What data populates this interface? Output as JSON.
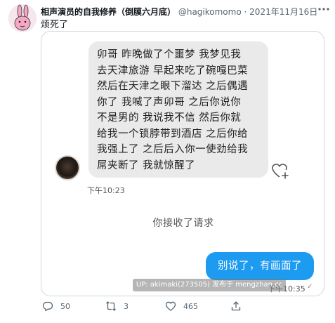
{
  "tweet": {
    "author_name": "相声演员的自我修养（倒膜六月底）",
    "handle": "@hagikomomo",
    "separator": "·",
    "date": "2021年11月16日",
    "text": "烦死了",
    "more_icon": "more-icon"
  },
  "chat": {
    "incoming_lines": [
      "卯哥 昨晚做了个噩梦 我梦见我",
      "去天津旅游 早起来吃了碗嘎巴菜",
      "然后在天津之眼下溜达 之后偶遇",
      "你了 我喊了声卯哥 之后你说你",
      "不是男的 我说我不信 然后你就",
      "给我一个锁脖带到酒店 之后你给",
      "我强上了 之后后入你一使劲给我",
      "屌夹断了 我就惊醒了"
    ],
    "incoming_time": "下午10:23",
    "system_message": "你接收了请求",
    "outgoing_text": "别说了，有画面了",
    "outgoing_time": "下午10:35",
    "watermark": "UP: akimaki(273505) 发布于 mengzhan.cc"
  },
  "actions": {
    "reply_count": "50",
    "retweet_count": "3",
    "like_count": "465"
  },
  "colors": {
    "accent": "#1d9bf0",
    "bubble_in": "#eaeaea",
    "muted_text": "#536471"
  }
}
